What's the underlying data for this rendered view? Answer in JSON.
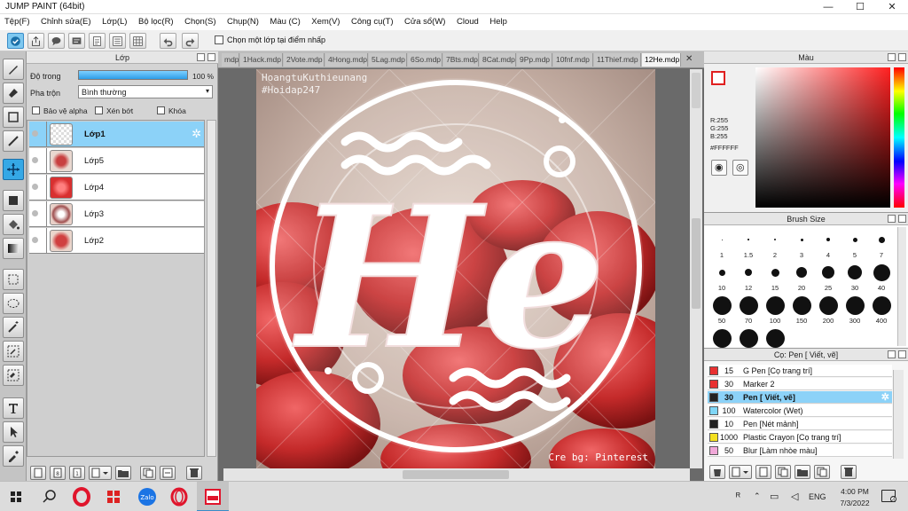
{
  "window": {
    "title": "JUMP PAINT (64bit)"
  },
  "menu": [
    "Tệp(F)",
    "Chỉnh sửa(E)",
    "Lớp(L)",
    "Bộ lọc(R)",
    "Chọn(S)",
    "Chụp(N)",
    "Màu (C)",
    "Xem(V)",
    "Công cụ(T)",
    "Cửa sổ(W)",
    "Cloud",
    "Help"
  ],
  "toolbar": {
    "select_one_label": "Chọn một lớp tại điểm nhấp"
  },
  "layer_panel": {
    "title": "Lớp",
    "opacity_label": "Độ trong",
    "opacity_value": "100 %",
    "opacity_fraction": 1.0,
    "blend_label": "Pha trộn",
    "blend_value": "Bình thường",
    "protect_alpha": "Bảo vệ alpha",
    "clip": "Xén bớt",
    "lock": "Khóa",
    "layers": [
      {
        "name": "Lớp1",
        "selected": true
      },
      {
        "name": "Lớp5",
        "selected": false
      },
      {
        "name": "Lớp4",
        "selected": false
      },
      {
        "name": "Lớp3",
        "selected": false
      },
      {
        "name": "Lớp2",
        "selected": false
      }
    ]
  },
  "tabs": [
    "mdp",
    "1Hack.mdp",
    "2Vote.mdp",
    "4Hong.mdp",
    "5Lag.mdp",
    "6So.mdp",
    "7Bts.mdp",
    "8Cat.mdp",
    "9Pp.mdp",
    "10fnf.mdp",
    "11Thief.mdp",
    "12He.mdp"
  ],
  "canvas": {
    "watermark1": "HoangtuKuthieunang",
    "watermark2": "#Hoidap247",
    "big_text": "He",
    "credit": "Cre bg: Pinterest"
  },
  "color_panel": {
    "title": "Màu",
    "r": "R:255",
    "g": "G:255",
    "b": "B:255",
    "hex": "#FFFFFF"
  },
  "brush_panel": {
    "title": "Brush Size",
    "sizes": [
      "1",
      "1.5",
      "2",
      "3",
      "4",
      "5",
      "7",
      "10",
      "12",
      "15",
      "20",
      "25",
      "30",
      "40",
      "50",
      "70",
      "100",
      "150",
      "200",
      "300",
      "400",
      "",
      "",
      ""
    ]
  },
  "pen_panel": {
    "title": "Cọ: Pen [ Viết, vẽ]",
    "items": [
      {
        "size": "15",
        "name": "G Pen [Cọ trang trí]",
        "color": "#e83030"
      },
      {
        "size": "30",
        "name": "Marker 2",
        "color": "#e83030"
      },
      {
        "size": "30",
        "name": "Pen [ Viết, vẽ]",
        "color": "#222222",
        "selected": true
      },
      {
        "size": "100",
        "name": "Watercolor (Wet)",
        "color": "#7fd6f6"
      },
      {
        "size": "10",
        "name": "Pen [Nét mảnh]",
        "color": "#222222"
      },
      {
        "size": "1000",
        "name": "Plastic Crayon [Cọ trang trí]",
        "color": "#f4e020"
      },
      {
        "size": "50",
        "name": "Blur [Làm nhòe màu]",
        "color": "#f0a8d8"
      }
    ]
  },
  "taskbar": {
    "lang": "ENG",
    "time": "4:00 PM",
    "date": "7/3/2022",
    "zalo": "Zalo"
  }
}
